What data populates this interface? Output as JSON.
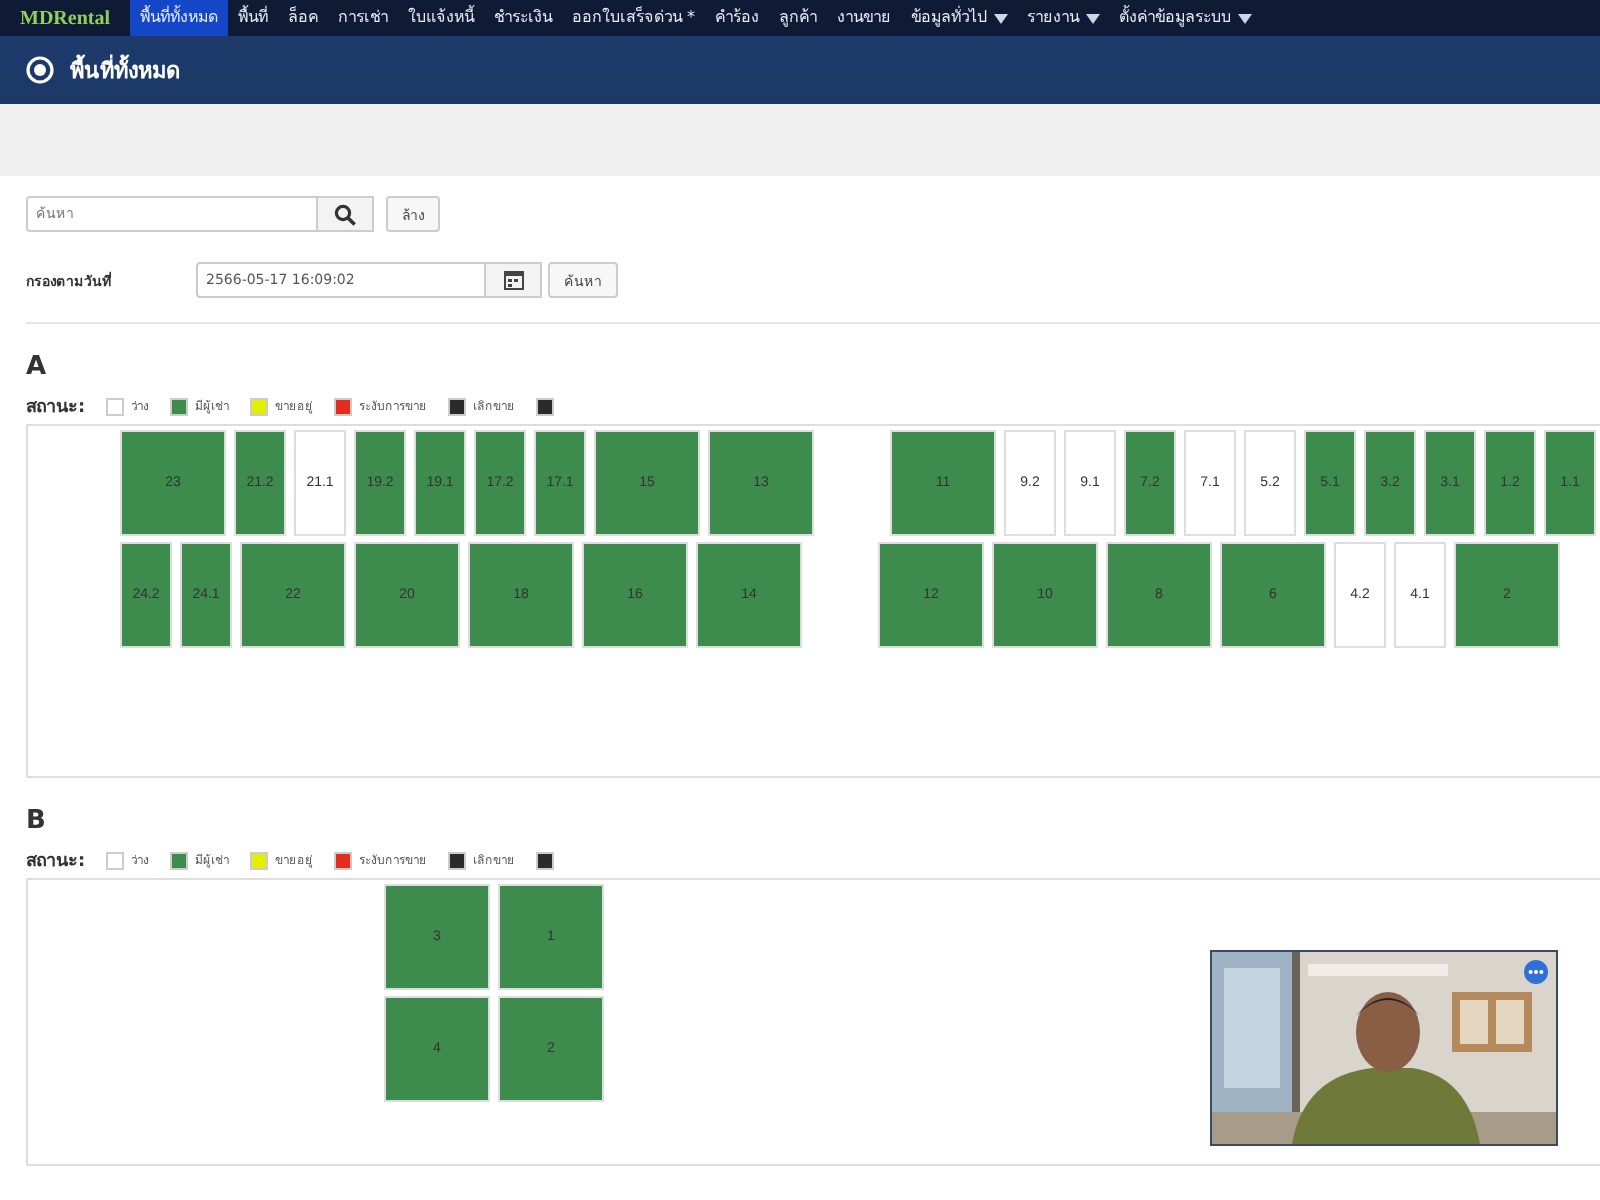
{
  "navbar": {
    "brand": "MDRental",
    "items": [
      {
        "label": "พื้นที่ทั้งหมด",
        "selected": true,
        "dropdown": false
      },
      {
        "label": "พื้นที่",
        "selected": false,
        "dropdown": false
      },
      {
        "label": "ล็อค",
        "selected": false,
        "dropdown": false
      },
      {
        "label": "การเช่า",
        "selected": false,
        "dropdown": false
      },
      {
        "label": "ใบแจ้งหนี้",
        "selected": false,
        "dropdown": false
      },
      {
        "label": "ชำระเงิน",
        "selected": false,
        "dropdown": false
      },
      {
        "label": "ออกใบเสร็จด่วน *",
        "selected": false,
        "dropdown": false
      },
      {
        "label": "คำร้อง",
        "selected": false,
        "dropdown": false
      },
      {
        "label": "ลูกค้า",
        "selected": false,
        "dropdown": false
      },
      {
        "label": "งานขาย",
        "selected": false,
        "dropdown": false
      },
      {
        "label": "ข้อมูลทั่วไป",
        "selected": false,
        "dropdown": true
      },
      {
        "label": "รายงาน",
        "selected": false,
        "dropdown": true
      },
      {
        "label": "ตั้งค่าข้อมูลระบบ",
        "selected": false,
        "dropdown": true
      }
    ]
  },
  "page_title": "พื้นที่ทั้งหมด",
  "search": {
    "placeholder": "ค้นหา",
    "clear_button": "ล้าง"
  },
  "date_filter": {
    "label": "กรองตามวันที่",
    "value": "2566-05-17 16:09:02",
    "button": "ค้นหา"
  },
  "zones": [
    {
      "name": "A",
      "status_label": "สถานะ:",
      "legend": [
        {
          "label": "ว่าง",
          "color": "#ffffff"
        },
        {
          "label": "มีผู้เช่า",
          "color": "#3e8b4e"
        },
        {
          "label": "ขายอยู่",
          "color": "#e2f000"
        },
        {
          "label": "ระงับการขาย",
          "color": "#e52c1c"
        },
        {
          "label": "เลิกขาย",
          "color": "#2b2b2b"
        },
        {
          "color": "#2b2b2b"
        }
      ],
      "rows": [
        {
          "groups": [
            [
              {
                "number": "23",
                "kind": "whole",
                "occupied": true
              },
              {
                "number": "21.2",
                "kind": "half",
                "occupied": true
              },
              {
                "number": "21.1",
                "kind": "half",
                "occupied": false
              },
              {
                "number": "19.2",
                "kind": "half",
                "occupied": true
              },
              {
                "number": "19.1",
                "kind": "half",
                "occupied": true
              },
              {
                "number": "17.2",
                "kind": "half",
                "occupied": true
              },
              {
                "number": "17.1",
                "kind": "half",
                "occupied": true
              },
              {
                "number": "15",
                "kind": "whole",
                "occupied": true
              },
              {
                "number": "13",
                "kind": "whole",
                "occupied": true
              }
            ],
            [
              {
                "number": "11",
                "kind": "whole",
                "occupied": true
              },
              {
                "number": "9.2",
                "kind": "half",
                "occupied": false
              },
              {
                "number": "9.1",
                "kind": "half",
                "occupied": false
              },
              {
                "number": "7.2",
                "kind": "half",
                "occupied": true
              },
              {
                "number": "7.1",
                "kind": "half",
                "occupied": false
              },
              {
                "number": "5.2",
                "kind": "half",
                "occupied": false
              },
              {
                "number": "5.1",
                "kind": "half",
                "occupied": true
              },
              {
                "number": "3.2",
                "kind": "half",
                "occupied": true
              },
              {
                "number": "3.1",
                "kind": "half",
                "occupied": true
              },
              {
                "number": "1.2",
                "kind": "half",
                "occupied": true
              },
              {
                "number": "1.1",
                "kind": "half",
                "occupied": true
              }
            ]
          ]
        },
        {
          "groups": [
            [
              {
                "number": "24.2",
                "kind": "half",
                "occupied": true
              },
              {
                "number": "24.1",
                "kind": "half",
                "occupied": true
              },
              {
                "number": "22",
                "kind": "whole",
                "occupied": true
              },
              {
                "number": "20",
                "kind": "whole",
                "occupied": true
              },
              {
                "number": "18",
                "kind": "whole",
                "occupied": true
              },
              {
                "number": "16",
                "kind": "whole",
                "occupied": true
              },
              {
                "number": "14",
                "kind": "whole",
                "occupied": true
              }
            ],
            [
              {
                "number": "12",
                "kind": "whole",
                "occupied": true
              },
              {
                "number": "10",
                "kind": "whole",
                "occupied": true
              },
              {
                "number": "8",
                "kind": "whole",
                "occupied": true
              },
              {
                "number": "6",
                "kind": "whole",
                "occupied": true
              },
              {
                "number": "4.2",
                "kind": "half",
                "occupied": false
              },
              {
                "number": "4.1",
                "kind": "half",
                "occupied": false
              },
              {
                "number": "2",
                "kind": "whole",
                "occupied": true
              }
            ]
          ]
        }
      ]
    },
    {
      "name": "B",
      "status_label": "สถานะ:",
      "legend": [
        {
          "label": "ว่าง",
          "color": "#ffffff"
        },
        {
          "label": "มีผู้เช่า",
          "color": "#3e8b4e"
        },
        {
          "label": "ขายอยู่",
          "color": "#e2f000"
        },
        {
          "label": "ระงับการขาย",
          "color": "#e52c1c"
        },
        {
          "label": "เลิกขาย",
          "color": "#2b2b2b"
        },
        {
          "color": "#2b2b2b"
        }
      ],
      "rows": [
        {
          "groups": [
            [
              {
                "number": "3",
                "kind": "whole",
                "occupied": true
              },
              {
                "number": "1",
                "kind": "whole",
                "occupied": true
              }
            ]
          ]
        },
        {
          "groups": [
            [
              {
                "number": "4",
                "kind": "whole",
                "occupied": true
              },
              {
                "number": "2",
                "kind": "whole",
                "occupied": true
              }
            ]
          ]
        }
      ]
    }
  ]
}
